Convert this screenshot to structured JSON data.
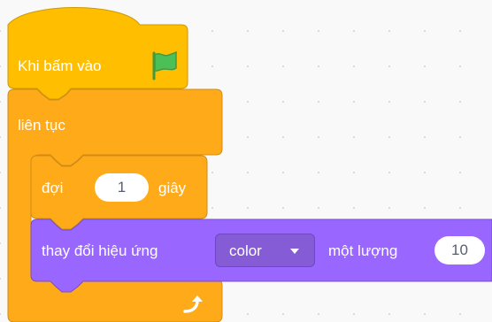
{
  "hat_block": {
    "label": "Khi bấm vào",
    "icon": "green-flag-icon",
    "color": "#ffbf00"
  },
  "forever_block": {
    "label": "liên tục",
    "end_icon": "loop-arrow-icon",
    "color": "#ffab19"
  },
  "wait_block": {
    "label_before": "đợi",
    "value": "1",
    "label_after": "giây",
    "color": "#ffab19"
  },
  "effect_block": {
    "label_before": "thay đổi hiệu ứng",
    "effect_selected": "color",
    "label_middle": "một lượng",
    "value": "10",
    "color": "#9966ff"
  }
}
